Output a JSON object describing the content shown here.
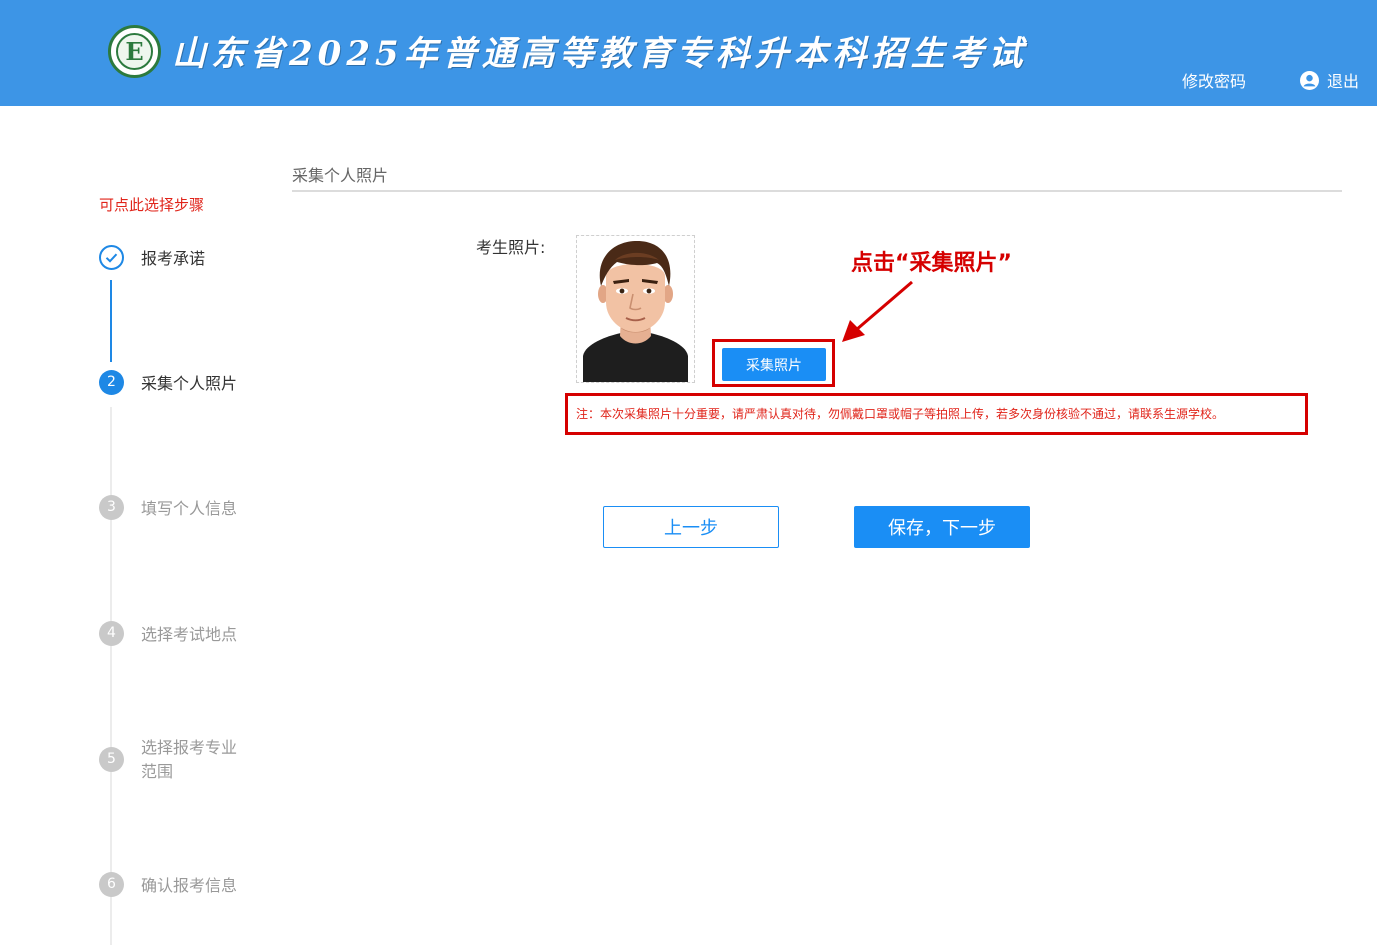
{
  "header": {
    "title": "山东省2025年普通高等教育专科升本科招生考试",
    "change_password": "修改密码",
    "logout": "退出",
    "logo_letter": "E"
  },
  "sidebar": {
    "hint": "可点此选择步骤",
    "steps": [
      {
        "number": "",
        "label": "报考承诺",
        "status": "done"
      },
      {
        "number": "2",
        "label": "采集个人照片",
        "status": "active"
      },
      {
        "number": "3",
        "label": "填写个人信息",
        "status": "pending"
      },
      {
        "number": "4",
        "label": "选择考试地点",
        "status": "pending"
      },
      {
        "number": "5",
        "label": "选择报考专业范围",
        "status": "pending"
      },
      {
        "number": "6",
        "label": "确认报考信息",
        "status": "pending"
      }
    ]
  },
  "main": {
    "section_title": "采集个人照片",
    "photo_label": "考生照片:",
    "capture_button": "采集照片",
    "note": "注：本次采集照片十分重要，请严肃认真对待，勿佩戴口罩或帽子等拍照上传，若多次身份核验不通过，请联系生源学校。",
    "callout": "点击“采集照片”",
    "prev_button": "上一步",
    "next_button": "保存，下一步"
  },
  "colors": {
    "header_bg": "#3d95e6",
    "primary": "#1a8ef5",
    "annotation_red": "#d50000",
    "hint_red": "#e0241a"
  }
}
